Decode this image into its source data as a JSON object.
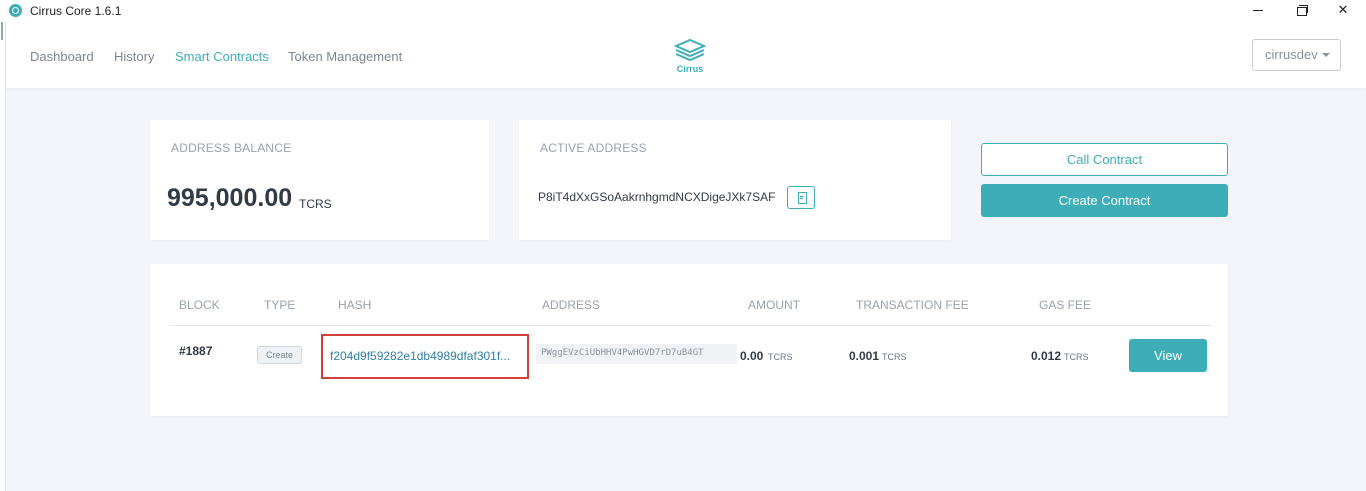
{
  "window": {
    "title": "Cirrus Core 1.6.1"
  },
  "nav": {
    "items": [
      {
        "label": "Dashboard"
      },
      {
        "label": "History"
      },
      {
        "label": "Smart Contracts"
      },
      {
        "label": "Token Management"
      }
    ],
    "active": "Smart Contracts",
    "logo_text": "Cirrus",
    "user": "cirrusdev"
  },
  "balance": {
    "label": "ADDRESS BALANCE",
    "value": "995,000.00",
    "unit": "TCRS"
  },
  "active_address": {
    "label": "ACTIVE ADDRESS",
    "value": "P8iT4dXxGSoAakrnhgmdNCXDigeJXk7SAF"
  },
  "actions": {
    "call_contract": "Call Contract",
    "create_contract": "Create Contract"
  },
  "table": {
    "columns": [
      "BLOCK",
      "TYPE",
      "HASH",
      "ADDRESS",
      "AMOUNT",
      "TRANSACTION FEE",
      "GAS FEE"
    ],
    "rows": [
      {
        "block": "#1887",
        "type": "Create",
        "hash": "f204d9f59282e1db4989dfaf301f...",
        "address": "PWggEVzCiUbHHV4PwHGVD7rD7uB4GT",
        "amount": "0.00",
        "amount_unit": "TCRS",
        "tx_fee": "0.001",
        "tx_fee_unit": "TCRS",
        "gas_fee": "0.012",
        "gas_fee_unit": "TCRS",
        "action": "View"
      }
    ]
  },
  "colors": {
    "accent": "#3daeb7",
    "highlight": "#d2403b",
    "link": "#2f7fa7"
  }
}
